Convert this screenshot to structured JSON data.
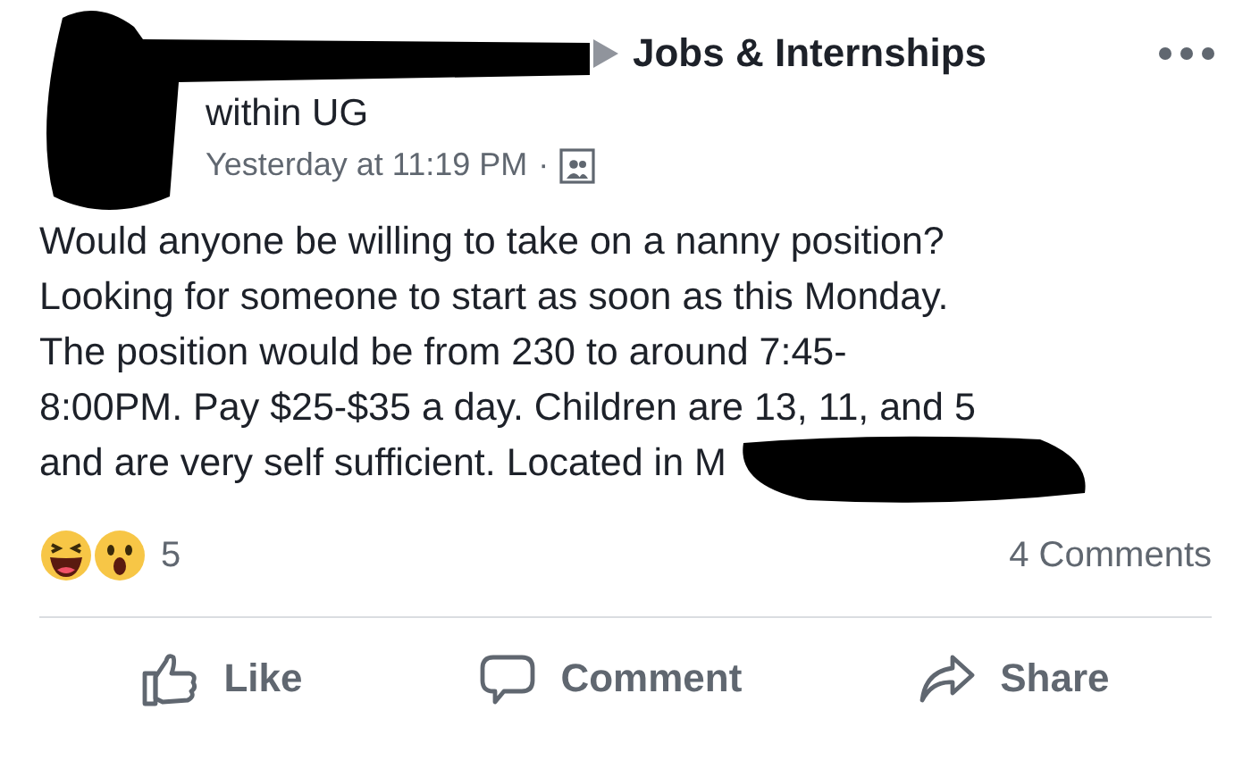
{
  "post": {
    "group": "Jobs & Internships",
    "audience": "within UG",
    "time": "Yesterday at 11:19 PM",
    "separator": "·",
    "body": [
      "Would anyone be willing to take on a nanny position?",
      "Looking for someone to start as soon as this Monday.",
      "The position would be from 230 to around 7:45-",
      "8:00PM. Pay $25-$35 a day. Children are 13, 11, and 5",
      "and are very self sufficient. Located in M"
    ]
  },
  "reactions": {
    "count": "5",
    "comments": "4 Comments"
  },
  "actions": [
    {
      "kind": "like",
      "label": "Like"
    },
    {
      "kind": "comment",
      "label": "Comment"
    },
    {
      "kind": "share",
      "label": "Share"
    }
  ]
}
